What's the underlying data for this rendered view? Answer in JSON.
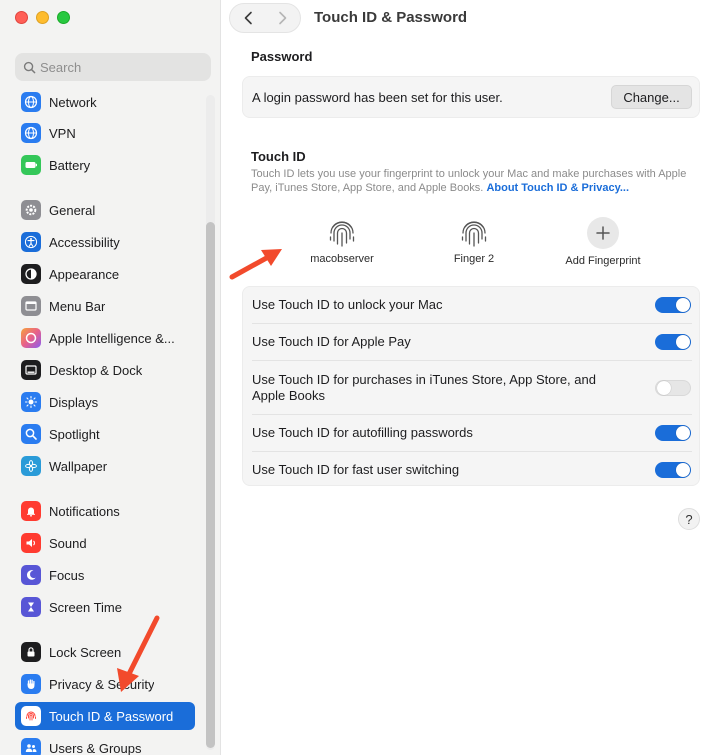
{
  "window": {
    "title": "Touch ID & Password",
    "back_icon": "chevron-left-icon",
    "forward_icon": "chevron-right-icon"
  },
  "search": {
    "placeholder": "Search"
  },
  "sidebar": {
    "items": [
      {
        "label": "Network",
        "icon": "globe-icon",
        "color": "#2a7cf0",
        "active": false
      },
      {
        "label": "VPN",
        "icon": "globe-icon",
        "color": "#2a7cf0",
        "active": false
      },
      {
        "label": "Battery",
        "icon": "battery-icon",
        "color": "#34c759",
        "active": false
      },
      {
        "label": "General",
        "icon": "gear-icon",
        "color": "#8e8e93",
        "active": false
      },
      {
        "label": "Accessibility",
        "icon": "accessibility-icon",
        "color": "#1a6dd9",
        "active": false
      },
      {
        "label": "Appearance",
        "icon": "appearance-icon",
        "color": "#1d1d1f",
        "active": false
      },
      {
        "label": "Menu Bar",
        "icon": "menubar-icon",
        "color": "#8e8e93",
        "active": false
      },
      {
        "label": "Apple Intelligence &...",
        "icon": "apple-intelligence-icon",
        "color": "#e8608a",
        "active": false
      },
      {
        "label": "Desktop & Dock",
        "icon": "dock-icon",
        "color": "#1d1d1f",
        "active": false
      },
      {
        "label": "Displays",
        "icon": "sun-icon",
        "color": "#2a7cf0",
        "active": false
      },
      {
        "label": "Spotlight",
        "icon": "magnifier-icon",
        "color": "#2a7cf0",
        "active": false
      },
      {
        "label": "Wallpaper",
        "icon": "flower-icon",
        "color": "#2a9bd8",
        "active": false
      },
      {
        "label": "Notifications",
        "icon": "bell-icon",
        "color": "#ff3b30",
        "active": false
      },
      {
        "label": "Sound",
        "icon": "speaker-icon",
        "color": "#ff3b30",
        "active": false
      },
      {
        "label": "Focus",
        "icon": "moon-icon",
        "color": "#5856d6",
        "active": false
      },
      {
        "label": "Screen Time",
        "icon": "hourglass-icon",
        "color": "#5856d6",
        "active": false
      },
      {
        "label": "Lock Screen",
        "icon": "lock-icon",
        "color": "#1d1d1f",
        "active": false
      },
      {
        "label": "Privacy & Security",
        "icon": "hand-icon",
        "color": "#2a7cf0",
        "active": false
      },
      {
        "label": "Touch ID & Password",
        "icon": "fingerprint-icon",
        "color": "#ff3b30",
        "active": true
      },
      {
        "label": "Users & Groups",
        "icon": "users-icon",
        "color": "#2a7cf0",
        "active": false
      }
    ]
  },
  "password": {
    "heading": "Password",
    "text": "A login password has been set for this user.",
    "button": "Change..."
  },
  "touchid": {
    "heading": "Touch ID",
    "description": "Touch ID lets you use your fingerprint to unlock your Mac and make purchases with Apple Pay, iTunes Store, App Store, and Apple Books.",
    "link": "About Touch ID & Privacy...",
    "fingers": [
      {
        "label": "macobserver"
      },
      {
        "label": "Finger 2"
      }
    ],
    "add_label": "Add Fingerprint"
  },
  "options": [
    {
      "label": "Use Touch ID to unlock your Mac",
      "on": true
    },
    {
      "label": "Use Touch ID for Apple Pay",
      "on": true
    },
    {
      "label": "Use Touch ID for purchases in iTunes Store, App Store, and Apple Books",
      "on": false
    },
    {
      "label": "Use Touch ID for autofilling passwords",
      "on": true
    },
    {
      "label": "Use Touch ID for fast user switching",
      "on": true
    }
  ],
  "help": {
    "label": "?"
  },
  "colors": {
    "accent": "#1a6dd9",
    "annotation": "#f24a2c"
  }
}
